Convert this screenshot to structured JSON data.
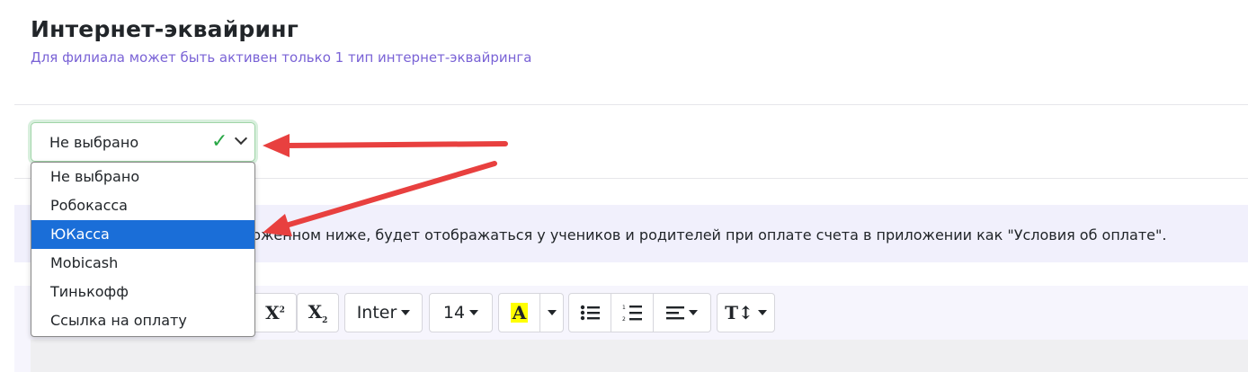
{
  "header": {
    "title": "Интернет-эквайринг",
    "subtitle": "Для филиала может быть активен только 1 тип интернет-эквайринга"
  },
  "acquiring_select": {
    "value": "Не выбрано",
    "options": [
      "Не выбрано",
      "Робокасса",
      "ЮКасса",
      "Mobicash",
      "Тинькофф",
      "Ссылка на оплату"
    ],
    "highlighted": "ЮКасса"
  },
  "hint": {
    "text": "ложенном ниже, будет отображаться у учеников и родителей при оплате счета в приложении как \"Условия об оплате\"."
  },
  "toolbar": {
    "superscript_label": "X",
    "subscript_label": "X",
    "font_family": "Inter",
    "font_size": "14",
    "text_color_label": "A"
  },
  "colors": {
    "accent": "#7a63d6",
    "selected_option": "#1a6ed8",
    "valid": "#28a745",
    "annotation_arrow": "#e8403f"
  }
}
